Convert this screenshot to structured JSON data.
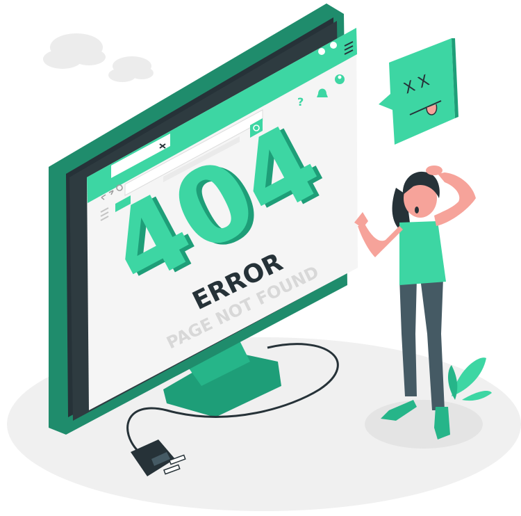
{
  "illustration": {
    "code": "404",
    "title": "ERROR",
    "subtitle": "PAGE NOT FOUND",
    "dead_face": "X X"
  },
  "colors": {
    "accent": "#3dd6a3",
    "accent_dark": "#1e9e78",
    "monitor_frame": "#1f8c6c",
    "monitor_side": "#2b2b2b",
    "screen_bg": "#f5f5f5",
    "shadow": "#ebebeb",
    "skin": "#f6a39a",
    "hair": "#263238",
    "pants": "#455a64"
  },
  "icons": [
    "cloud-icon",
    "help-icon",
    "bell-icon",
    "user-icon",
    "search-icon",
    "close-icon",
    "back-arrow-icon",
    "forward-arrow-icon",
    "refresh-icon",
    "menu-icon",
    "plug-icon",
    "plant-icon",
    "dead-face-speech-bubble-icon"
  ]
}
